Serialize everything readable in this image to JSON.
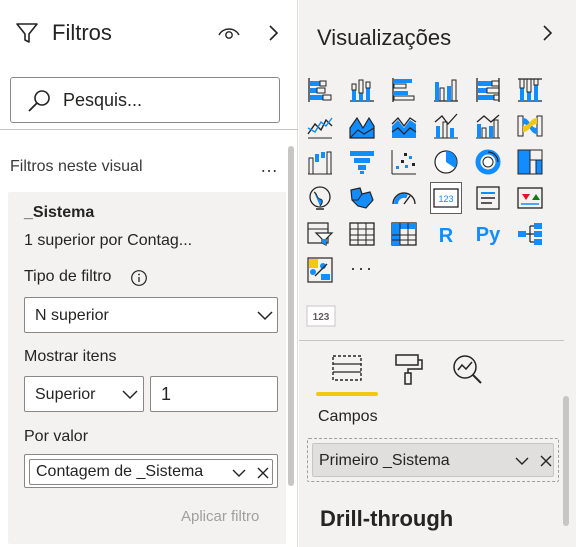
{
  "filters": {
    "title": "Filtros",
    "search_placeholder": "Pesquis...",
    "section_label": "Filtros neste visual",
    "more": "…",
    "card": {
      "title": "_Sistema",
      "subtitle": "1 superior por Contag...",
      "filter_type_label": "Tipo de filtro",
      "filter_type_value": "N superior",
      "show_items_label": "Mostrar itens",
      "show_items_direction": "Superior",
      "show_items_count": "1",
      "by_value_label": "Por valor",
      "by_value_field": "Contagem de _Sistema",
      "apply_label": "Aplicar filtro"
    }
  },
  "visualizations": {
    "title": "Visualizações",
    "more": "···",
    "icons": [
      "stacked-bar-chart-icon",
      "stacked-column-chart-icon",
      "clustered-bar-chart-icon",
      "clustered-column-chart-icon",
      "100-stacked-bar-chart-icon",
      "100-stacked-column-chart-icon",
      "line-chart-icon",
      "area-chart-icon",
      "stacked-area-chart-icon",
      "line-and-stacked-column-chart-icon",
      "line-and-clustered-column-chart-icon",
      "ribbon-chart-icon",
      "waterfall-chart-icon",
      "funnel-chart-icon",
      "scatter-chart-icon",
      "pie-chart-icon",
      "donut-chart-icon",
      "treemap-icon",
      "map-icon",
      "filled-map-icon",
      "gauge-icon",
      "card-icon",
      "multi-row-card-icon",
      "kpi-icon",
      "slicer-icon",
      "table-icon",
      "matrix-icon",
      "r-script-visual-icon",
      "python-visual-icon",
      "decomposition-tree-icon",
      "key-influencers-icon"
    ],
    "r_label": "R",
    "py_label": "Py",
    "card_icon_text": "123",
    "tabs": [
      "fields-tab",
      "format-tab",
      "analytics-tab"
    ],
    "campos_label": "Campos",
    "field_value": "Primeiro _Sistema",
    "drill_label": "Drill-through"
  },
  "colors": {
    "accent_yellow": "#f2c811",
    "icon_blue": "#118dff",
    "icon_dark": "#252423"
  }
}
